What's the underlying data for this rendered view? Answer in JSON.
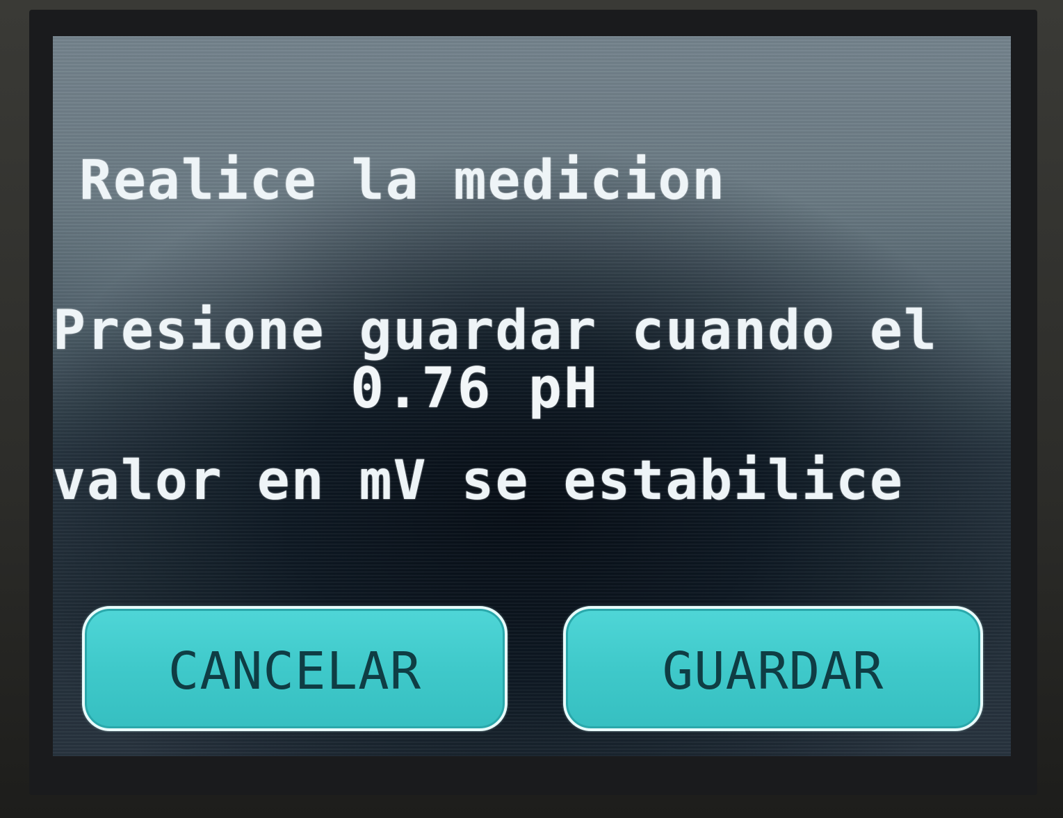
{
  "prompt": {
    "line1": "Realice la medicion",
    "line2": "Presione guardar cuando el",
    "line3": "valor en mV se estabilice"
  },
  "reading": {
    "value": "0.76 pH"
  },
  "buttons": {
    "cancel_label": "CANCELAR",
    "save_label": "GUARDAR"
  },
  "colors": {
    "button_fill": "#3fc9ca",
    "button_border": "#e8fbfb",
    "button_text": "#0f3d44",
    "text": "#eef4f7"
  }
}
